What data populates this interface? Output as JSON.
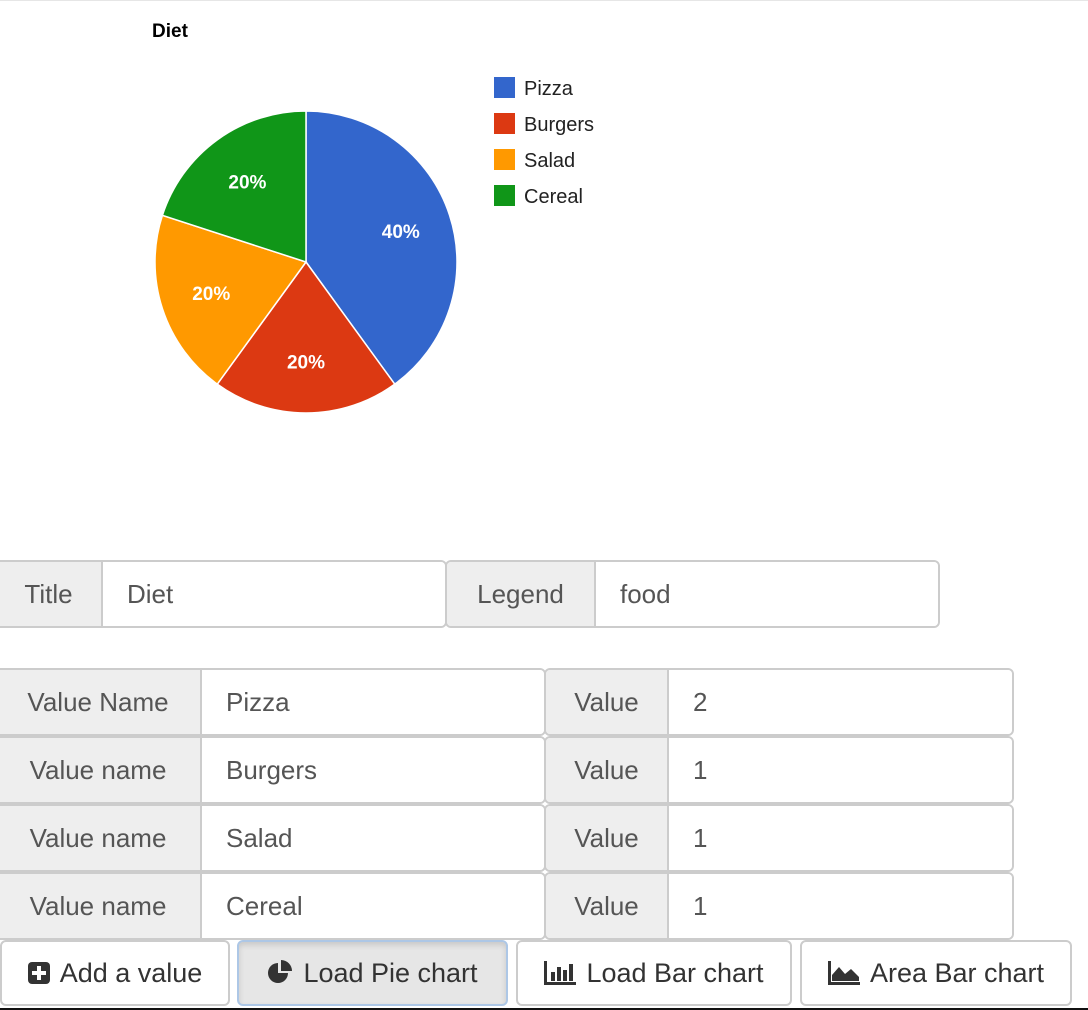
{
  "chart_data": {
    "type": "pie",
    "title": "Diet",
    "categories": [
      "Pizza",
      "Burgers",
      "Salad",
      "Cereal"
    ],
    "values": [
      2,
      1,
      1,
      1
    ],
    "slice_labels": [
      "40%",
      "20%",
      "20%",
      "20%"
    ],
    "colors": [
      "#3366cc",
      "#dc3912",
      "#ff9900",
      "#109618"
    ],
    "legend_position": "right"
  },
  "form": {
    "title_label": "Title",
    "title_value": "Diet",
    "legend_label": "Legend",
    "legend_value": "food",
    "rows": [
      {
        "name_label": "Value Name",
        "name_value": "Pizza",
        "value_label": "Value",
        "value": "2"
      },
      {
        "name_label": "Value name",
        "name_value": "Burgers",
        "value_label": "Value",
        "value": "1"
      },
      {
        "name_label": "Value name",
        "name_value": "Salad",
        "value_label": "Value",
        "value": "1"
      },
      {
        "name_label": "Value name",
        "name_value": "Cereal",
        "value_label": "Value",
        "value": "1"
      }
    ]
  },
  "buttons": {
    "add_value": {
      "label": "Add a value",
      "icon": "plus-square-icon"
    },
    "load_pie": {
      "label": "Load Pie chart",
      "icon": "pie-chart-icon"
    },
    "load_bar": {
      "label": "Load Bar chart",
      "icon": "bar-chart-icon"
    },
    "area_bar": {
      "label": "Area Bar chart",
      "icon": "area-chart-icon"
    }
  }
}
